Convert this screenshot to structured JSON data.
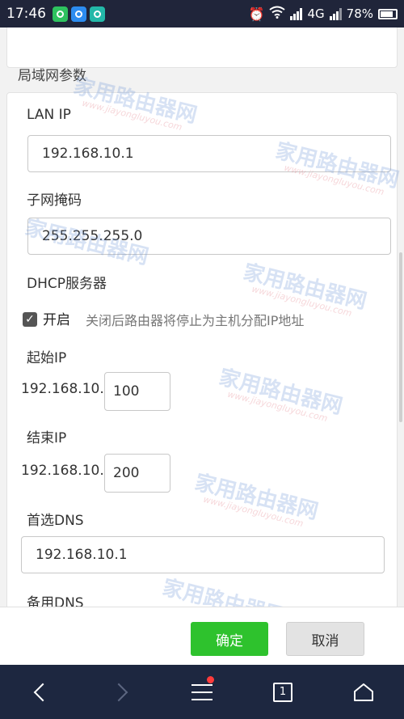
{
  "status_bar": {
    "time": "17:46",
    "network": "4G",
    "battery": "78%"
  },
  "section_title": "局域网参数",
  "form": {
    "lan_ip_label": "LAN IP",
    "lan_ip_value": "192.168.10.1",
    "subnet_label": "子网掩码",
    "subnet_value": "255.255.255.0",
    "dhcp_label": "DHCP服务器",
    "dhcp_enabled_label": "开启",
    "dhcp_hint": "关闭后路由器将停止为主机分配IP地址",
    "start_ip_label": "起始IP",
    "start_ip_prefix": "192.168.10.",
    "start_ip_value": "100",
    "end_ip_label": "结束IP",
    "end_ip_prefix": "192.168.10.",
    "end_ip_value": "200",
    "primary_dns_label": "首选DNS",
    "primary_dns_value": "192.168.10.1",
    "backup_dns_label": "备用DNS"
  },
  "footer": {
    "confirm_label": "确定",
    "cancel_label": "取消"
  },
  "nav_bar": {
    "tab_count": "1"
  },
  "watermark": {
    "text": "家用路由器网",
    "url": "www.jiayongluyou.com"
  }
}
